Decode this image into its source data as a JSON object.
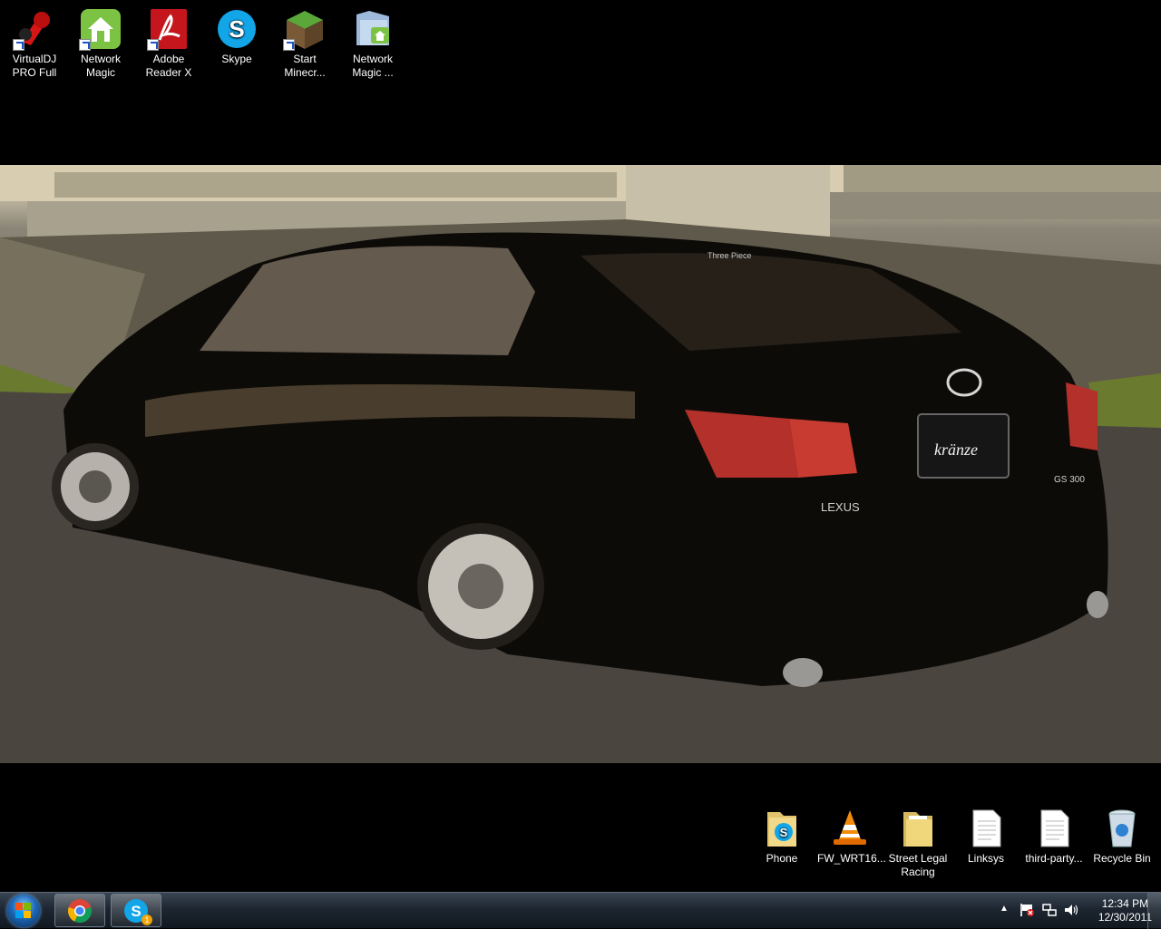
{
  "desktop_icons_top": [
    {
      "label": "VirtualDJ PRO Full",
      "icon": "virtualdj-icon"
    },
    {
      "label": "Network Magic",
      "icon": "network-magic-icon"
    },
    {
      "label": "Adobe Reader X",
      "icon": "adobe-reader-icon"
    },
    {
      "label": "Skype",
      "icon": "skype-icon"
    },
    {
      "label": "Start Minecr...",
      "icon": "minecraft-icon"
    },
    {
      "label": "Network Magic ...",
      "icon": "network-magic-folder-icon"
    }
  ],
  "desktop_icons_bottom": [
    {
      "label": "Phone",
      "icon": "skype-folder-icon"
    },
    {
      "label": "FW_WRT16...",
      "icon": "vlc-icon"
    },
    {
      "label": "Street Legal Racing",
      "icon": "folder-icon"
    },
    {
      "label": "Linksys",
      "icon": "text-file-icon"
    },
    {
      "label": "third-party...",
      "icon": "text-file-icon"
    },
    {
      "label": "Recycle Bin",
      "icon": "recycle-bin-icon"
    }
  ],
  "wallpaper": {
    "description_text": [
      "Three Piece",
      "kränze",
      "LEXUS",
      "GS 300"
    ]
  },
  "taskbar": {
    "pinned": [
      {
        "name": "Google Chrome",
        "icon": "chrome-icon"
      },
      {
        "name": "Skype",
        "icon": "skype-icon",
        "badge": "1"
      }
    ],
    "tray": {
      "time": "12:34 PM",
      "date": "12/30/2011"
    }
  }
}
